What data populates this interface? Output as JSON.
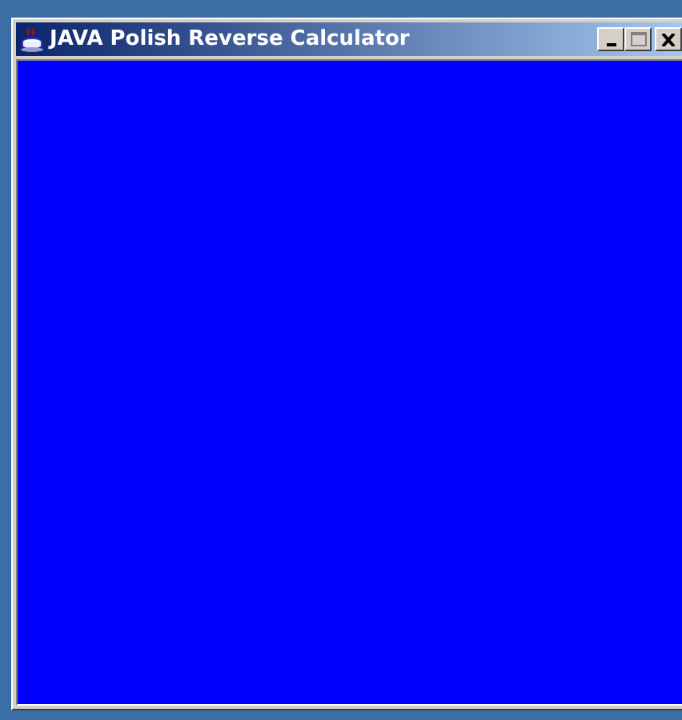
{
  "window": {
    "title": "JAVA Polish Reverse Calculator"
  },
  "window_buttons": [
    {
      "kind": "minimize",
      "disabled": false
    },
    {
      "kind": "maximize",
      "disabled": true
    },
    {
      "kind": "close",
      "disabled": false
    }
  ]
}
